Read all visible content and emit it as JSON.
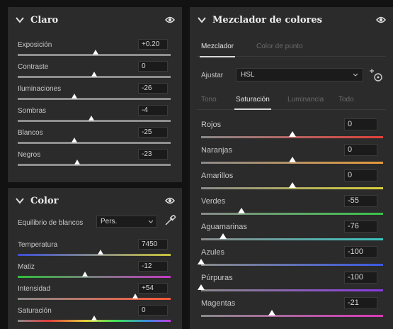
{
  "claro": {
    "title": "Claro",
    "sliders": [
      {
        "label": "Exposición",
        "value": "+0.20",
        "position": 0.51,
        "track": "#8f8f8f"
      },
      {
        "label": "Contraste",
        "value": "0",
        "position": 0.5,
        "track": "#8f8f8f"
      },
      {
        "label": "Iluminaciones",
        "value": "-26",
        "position": 0.37,
        "track": "#8f8f8f"
      },
      {
        "label": "Sombras",
        "value": "-4",
        "position": 0.48,
        "track": "#8f8f8f"
      },
      {
        "label": "Blancos",
        "value": "-25",
        "position": 0.37,
        "track": "#8f8f8f"
      },
      {
        "label": "Negros",
        "value": "-23",
        "position": 0.39,
        "track": "#8f8f8f"
      }
    ]
  },
  "color": {
    "title": "Color",
    "white_balance_label": "Equilibrio de blancos",
    "white_balance_value": "Pers.",
    "sliders": [
      {
        "label": "Temperatura",
        "value": "7450",
        "position": 0.54,
        "track": "linear-gradient(90deg,#3d4fd6,#c9c23a)"
      },
      {
        "label": "Matiz",
        "value": "-12",
        "position": 0.44,
        "track": "linear-gradient(90deg,#2fbf3a,#c43ac4)"
      },
      {
        "label": "Intensidad",
        "value": "+54",
        "position": 0.77,
        "track": "linear-gradient(90deg,#8a8a8a,#ff5a3a)"
      },
      {
        "label": "Saturación",
        "value": "0",
        "position": 0.5,
        "track": "linear-gradient(90deg,#8a8a8a,#e23a3a 20%,#e2d33a 45%,#3ae25a 65%,#3a8ae2 85%,#c43ae2)"
      }
    ]
  },
  "mixer": {
    "title": "Mezclador de colores",
    "tabs": [
      "Mezclador",
      "Color de punto"
    ],
    "adjust_label": "Ajustar",
    "adjust_value": "HSL",
    "subtabs": [
      "Tono",
      "Saturación",
      "Luminancia",
      "Todo"
    ],
    "sliders": [
      {
        "label": "Rojos",
        "value": "0",
        "position": 0.5,
        "track": "linear-gradient(90deg,#8a8a8a,#e2403a)"
      },
      {
        "label": "Naranjas",
        "value": "0",
        "position": 0.5,
        "track": "linear-gradient(90deg,#8a8a8a,#e59a3a)"
      },
      {
        "label": "Amarillos",
        "value": "0",
        "position": 0.5,
        "track": "linear-gradient(90deg,#8a8a8a,#d8d03a)"
      },
      {
        "label": "Verdes",
        "value": "-55",
        "position": 0.22,
        "track": "linear-gradient(90deg,#8a8a8a,#3ac44a)"
      },
      {
        "label": "Aguamarinas",
        "value": "-76",
        "position": 0.12,
        "track": "linear-gradient(90deg,#8a8a8a,#3ac4c0)"
      },
      {
        "label": "Azules",
        "value": "-100",
        "position": 0.0,
        "track": "linear-gradient(90deg,#8a8a8a,#3a5ae2)"
      },
      {
        "label": "Púrpuras",
        "value": "-100",
        "position": 0.0,
        "track": "linear-gradient(90deg,#8a8a8a,#8a3ae2)"
      },
      {
        "label": "Magentas",
        "value": "-21",
        "position": 0.39,
        "track": "linear-gradient(90deg,#8a8a8a,#d83ab8)"
      }
    ]
  }
}
